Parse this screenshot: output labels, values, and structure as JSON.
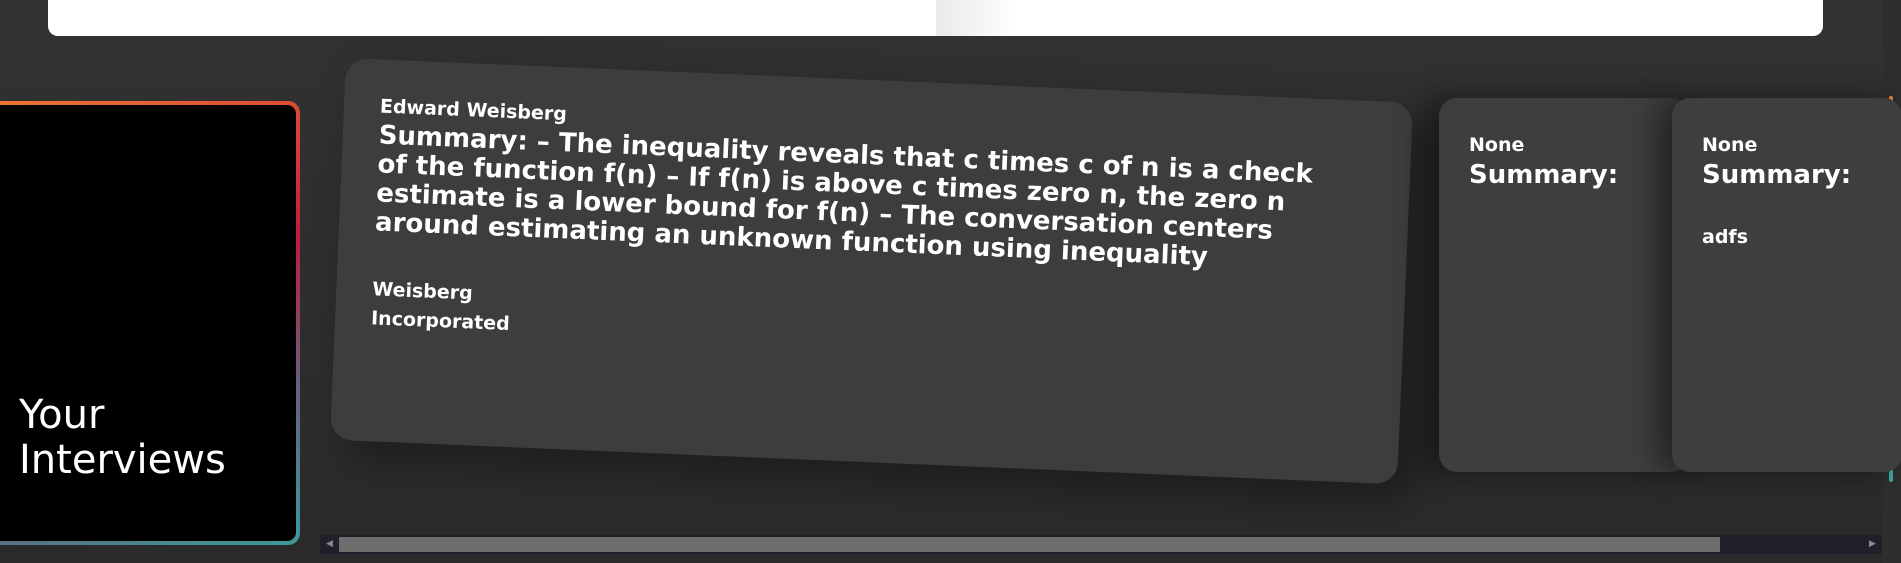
{
  "hero": {
    "title": "Your Interviews"
  },
  "interviews": [
    {
      "author": "Edward Weisberg",
      "summary": "Summary: – The inequality reveals that c times c of n is a check of the function f(n) – If f(n) is above c times zero n, the zero n estimate is a lower bound for f(n) – The conversation centers around estimating an unknown function using inequality",
      "company": "Weisberg Incorporated"
    },
    {
      "author": "None",
      "summary": "Summary:",
      "company": ""
    },
    {
      "author": "None",
      "summary": "Summary:",
      "company": "adfs"
    }
  ],
  "scrollbar": {
    "left_icon": "left-arrow-icon",
    "right_icon": "right-arrow-icon",
    "left_glyph": "◀",
    "right_glyph": "▶"
  },
  "colors": {
    "accent_orange": "#f07a2e",
    "accent_red": "#c31b3e",
    "accent_teal": "#3a9a99",
    "card_bg": "#3d3d3d",
    "page_bg": "#2c2c2c"
  }
}
